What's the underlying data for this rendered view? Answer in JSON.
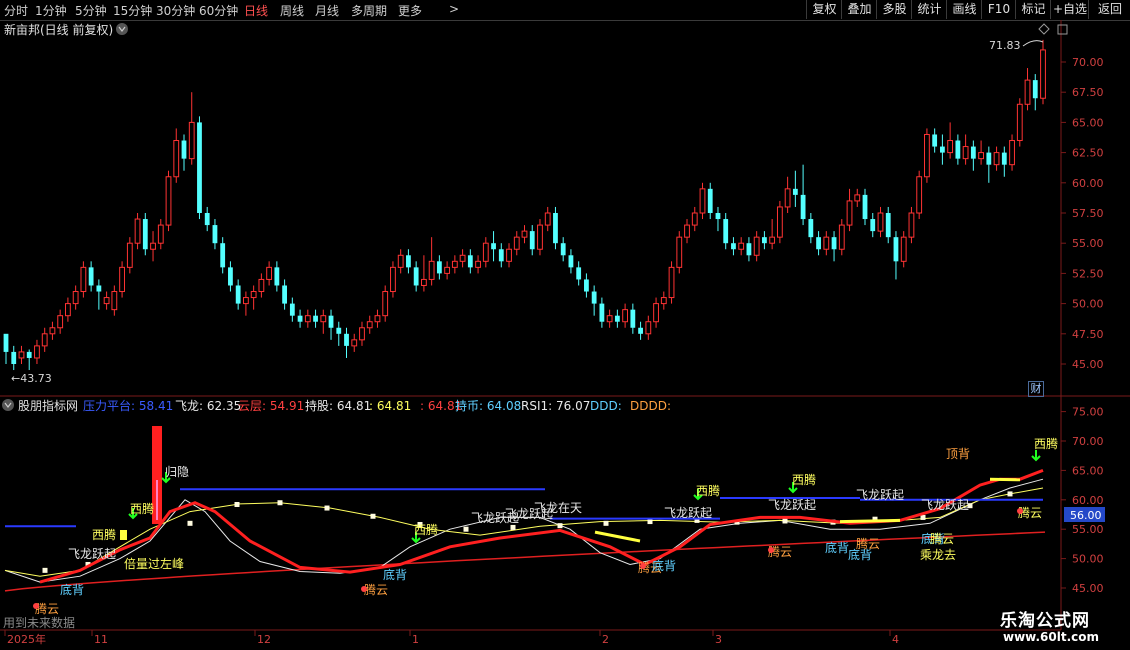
{
  "toolbar": {
    "timeframes": [
      "分时",
      "1分钟",
      "5分钟",
      "15分钟",
      "30分钟",
      "60分钟",
      "日线",
      "周线",
      "月线",
      "多周期",
      "更多"
    ],
    "active_index": 6,
    "more_arrow": ">",
    "buttons": [
      "复权",
      "叠加",
      "多股",
      "统计",
      "画线",
      "F10",
      "标记",
      "+自选",
      "返回"
    ]
  },
  "main_panel": {
    "title": "新亩邦(日线 前复权)",
    "price_ticks": [
      "70.00",
      "67.50",
      "65.00",
      "62.50",
      "60.00",
      "57.50",
      "55.00",
      "52.50",
      "50.00",
      "47.50",
      "45.00"
    ],
    "high_label": "71.83",
    "low_label": "43.73",
    "cai_badge": "财"
  },
  "indicator_panel": {
    "name": "股朋指标网",
    "legend": [
      {
        "text": "压力平台: 58.41",
        "color": "#3a5bff"
      },
      {
        "text": "飞龙: 62.35",
        "color": "#e8e8e8"
      },
      {
        "text": "云层: 54.91",
        "color": "#ff4040"
      },
      {
        "text": "持股: 64.81",
        "color": "#e8e8e8"
      },
      {
        "text": ": 64.81",
        "color": "#ffff60"
      },
      {
        "text": ": 64.81",
        "color": "#ff4040"
      },
      {
        "text": "持币: 64.08",
        "color": "#60d0ff"
      },
      {
        "text": "RSI1: 76.07",
        "color": "#e8e8e8"
      },
      {
        "text": "DDD:",
        "color": "#60d0ff"
      },
      {
        "text": "DDDD:",
        "color": "#ffa040"
      }
    ],
    "ticks": [
      "75.00",
      "70.00",
      "65.00",
      "60.00",
      "55.00",
      "50.00",
      "45.00"
    ],
    "current_value": "56.00",
    "annotations": {
      "tengyun": "腾云",
      "dibei": "底背",
      "feilong": "飞龙跃起",
      "xilong": "西腾",
      "guiyin": "归隐",
      "beiliang": "倍量过左峰",
      "feilong_sky": "飞龙在天",
      "dingbei": "顶背",
      "chenglong": "乘龙去",
      "beifang": "底背",
      "tengyun2": "腾云"
    }
  },
  "date_axis": [
    "2025年",
    "11",
    "12",
    "1",
    "2",
    "3",
    "4"
  ],
  "footer_note": "用到未来数据",
  "watermark": {
    "cn": "乐淘公式网",
    "url": "www.60lt.com"
  },
  "chart_data": {
    "type": "candlestick",
    "candles": [
      [
        47.5,
        46.0,
        45.0,
        47.0
      ],
      [
        46.0,
        45.0,
        44.5,
        46.5
      ],
      [
        45.5,
        46.0,
        45.0,
        46.5
      ],
      [
        46.0,
        45.5,
        44.5,
        46.2
      ],
      [
        45.5,
        46.5,
        45.0,
        47.0
      ],
      [
        46.5,
        47.5,
        46.0,
        48.0
      ],
      [
        47.5,
        48.0,
        47.0,
        48.5
      ],
      [
        48.0,
        49.0,
        47.5,
        49.5
      ],
      [
        49.0,
        50.0,
        48.5,
        50.5
      ],
      [
        50.0,
        51.0,
        49.5,
        51.5
      ],
      [
        51.0,
        53.0,
        50.5,
        53.5
      ],
      [
        53.0,
        51.5,
        51.0,
        53.5
      ],
      [
        51.5,
        51.0,
        49.5,
        52.0
      ],
      [
        50.0,
        50.5,
        49.5,
        51.0
      ],
      [
        49.5,
        51.0,
        49.0,
        51.5
      ],
      [
        51.0,
        53.0,
        50.5,
        53.5
      ],
      [
        53.0,
        55.0,
        52.5,
        55.5
      ],
      [
        55.0,
        57.0,
        54.5,
        57.5
      ],
      [
        57.0,
        54.5,
        54.0,
        57.5
      ],
      [
        54.5,
        55.0,
        53.5,
        56.0
      ],
      [
        55.0,
        56.5,
        54.5,
        57.0
      ],
      [
        56.5,
        60.5,
        56.0,
        61.0
      ],
      [
        60.5,
        63.5,
        60.0,
        64.5
      ],
      [
        63.5,
        62.0,
        61.0,
        64.0
      ],
      [
        62.0,
        65.0,
        61.5,
        67.5
      ],
      [
        65.0,
        57.5,
        57.0,
        65.5
      ],
      [
        57.5,
        56.5,
        56.0,
        58.0
      ],
      [
        56.5,
        55.0,
        54.5,
        57.0
      ],
      [
        55.0,
        53.0,
        52.5,
        55.5
      ],
      [
        53.0,
        51.5,
        51.0,
        53.5
      ],
      [
        51.5,
        50.0,
        49.5,
        52.0
      ],
      [
        50.0,
        50.5,
        49.0,
        51.0
      ],
      [
        50.5,
        51.0,
        49.5,
        51.5
      ],
      [
        51.0,
        52.0,
        50.5,
        52.5
      ],
      [
        52.0,
        53.0,
        51.5,
        53.5
      ],
      [
        53.0,
        51.5,
        51.0,
        53.5
      ],
      [
        51.5,
        50.0,
        49.5,
        52.0
      ],
      [
        50.0,
        49.0,
        48.5,
        50.5
      ],
      [
        49.0,
        48.5,
        48.0,
        49.5
      ],
      [
        48.5,
        49.0,
        48.0,
        49.5
      ],
      [
        49.0,
        48.5,
        48.0,
        49.5
      ],
      [
        48.5,
        49.0,
        47.5,
        49.5
      ],
      [
        49.0,
        48.0,
        47.0,
        49.5
      ],
      [
        48.0,
        47.5,
        46.5,
        48.5
      ],
      [
        47.5,
        46.5,
        45.5,
        48.0
      ],
      [
        46.5,
        47.0,
        46.0,
        47.5
      ],
      [
        47.0,
        48.0,
        46.5,
        48.5
      ],
      [
        48.0,
        48.5,
        47.5,
        49.0
      ],
      [
        48.5,
        49.0,
        48.0,
        49.5
      ],
      [
        49.0,
        51.0,
        48.5,
        51.5
      ],
      [
        51.0,
        53.0,
        50.5,
        53.5
      ],
      [
        53.0,
        54.0,
        52.5,
        54.5
      ],
      [
        54.0,
        53.0,
        52.5,
        54.5
      ],
      [
        53.0,
        51.5,
        51.0,
        53.5
      ],
      [
        51.5,
        52.0,
        51.0,
        54.0
      ],
      [
        52.0,
        53.5,
        51.5,
        55.5
      ],
      [
        53.5,
        52.5,
        52.0,
        54.0
      ],
      [
        52.5,
        53.0,
        52.0,
        53.5
      ],
      [
        53.0,
        53.5,
        52.5,
        54.0
      ],
      [
        53.5,
        54.0,
        53.0,
        54.5
      ],
      [
        54.0,
        53.0,
        52.5,
        54.5
      ],
      [
        53.0,
        53.5,
        52.5,
        54.0
      ],
      [
        53.5,
        55.0,
        53.0,
        55.5
      ],
      [
        55.0,
        54.5,
        53.5,
        56.0
      ],
      [
        54.5,
        53.5,
        53.0,
        55.0
      ],
      [
        53.5,
        54.5,
        53.0,
        55.0
      ],
      [
        54.5,
        55.5,
        54.0,
        56.0
      ],
      [
        55.5,
        56.0,
        55.0,
        56.5
      ],
      [
        56.0,
        54.5,
        54.0,
        56.5
      ],
      [
        54.5,
        56.5,
        54.0,
        57.0
      ],
      [
        56.5,
        57.5,
        56.0,
        58.0
      ],
      [
        57.5,
        55.0,
        54.5,
        58.0
      ],
      [
        55.0,
        54.0,
        53.5,
        55.5
      ],
      [
        54.0,
        53.0,
        52.5,
        54.5
      ],
      [
        53.0,
        52.0,
        51.5,
        53.5
      ],
      [
        52.0,
        51.0,
        50.5,
        52.5
      ],
      [
        51.0,
        50.0,
        49.0,
        51.5
      ],
      [
        50.0,
        48.5,
        48.0,
        50.5
      ],
      [
        48.5,
        49.0,
        48.0,
        49.5
      ],
      [
        49.0,
        48.5,
        48.0,
        49.5
      ],
      [
        48.5,
        49.5,
        48.0,
        50.0
      ],
      [
        49.5,
        48.0,
        47.5,
        50.0
      ],
      [
        48.0,
        47.5,
        47.0,
        48.5
      ],
      [
        47.5,
        48.5,
        47.0,
        49.0
      ],
      [
        48.5,
        50.0,
        48.0,
        50.5
      ],
      [
        50.0,
        50.5,
        49.5,
        51.0
      ],
      [
        50.5,
        53.0,
        50.0,
        53.5
      ],
      [
        53.0,
        55.5,
        52.5,
        56.0
      ],
      [
        55.5,
        56.5,
        55.0,
        57.0
      ],
      [
        56.5,
        57.5,
        56.0,
        58.0
      ],
      [
        57.5,
        59.5,
        57.0,
        60.0
      ],
      [
        59.5,
        57.5,
        57.0,
        60.0
      ],
      [
        57.5,
        57.0,
        56.0,
        58.0
      ],
      [
        57.0,
        55.0,
        54.5,
        57.5
      ],
      [
        55.0,
        54.5,
        54.0,
        55.5
      ],
      [
        54.5,
        55.0,
        54.0,
        55.5
      ],
      [
        55.0,
        54.0,
        53.5,
        55.5
      ],
      [
        54.0,
        55.5,
        53.5,
        56.0
      ],
      [
        55.5,
        55.0,
        54.5,
        56.0
      ],
      [
        55.0,
        55.5,
        54.5,
        57.0
      ],
      [
        55.5,
        58.0,
        55.0,
        58.5
      ],
      [
        58.0,
        59.5,
        57.5,
        60.5
      ],
      [
        59.5,
        59.0,
        58.0,
        61.0
      ],
      [
        59.0,
        57.0,
        56.5,
        61.5
      ],
      [
        57.0,
        55.5,
        55.0,
        57.5
      ],
      [
        55.5,
        54.5,
        54.0,
        56.0
      ],
      [
        54.5,
        55.5,
        54.0,
        56.0
      ],
      [
        55.5,
        54.5,
        53.5,
        56.0
      ],
      [
        54.5,
        56.5,
        54.0,
        57.0
      ],
      [
        56.5,
        58.5,
        56.0,
        59.5
      ],
      [
        58.5,
        59.0,
        58.0,
        59.5
      ],
      [
        59.0,
        57.0,
        56.5,
        59.5
      ],
      [
        57.0,
        56.0,
        55.5,
        57.5
      ],
      [
        56.0,
        57.5,
        55.5,
        58.0
      ],
      [
        57.5,
        55.5,
        55.0,
        58.0
      ],
      [
        55.5,
        53.5,
        52.0,
        56.0
      ],
      [
        53.5,
        55.5,
        53.0,
        56.0
      ],
      [
        55.5,
        57.5,
        55.0,
        58.0
      ],
      [
        57.5,
        60.5,
        57.0,
        61.0
      ],
      [
        60.5,
        64.0,
        60.0,
        64.5
      ],
      [
        64.0,
        63.0,
        62.5,
        64.5
      ],
      [
        63.0,
        62.5,
        61.5,
        64.0
      ],
      [
        62.5,
        63.5,
        62.0,
        65.0
      ],
      [
        63.5,
        62.0,
        61.5,
        64.0
      ],
      [
        62.0,
        63.0,
        61.5,
        64.0
      ],
      [
        63.0,
        62.0,
        61.0,
        63.5
      ],
      [
        62.0,
        62.5,
        61.5,
        63.5
      ],
      [
        62.5,
        61.5,
        60.0,
        63.0
      ],
      [
        61.5,
        62.5,
        61.0,
        63.0
      ],
      [
        62.5,
        61.5,
        60.5,
        63.0
      ],
      [
        61.5,
        63.5,
        61.0,
        64.0
      ],
      [
        63.5,
        66.5,
        63.0,
        67.0
      ],
      [
        66.5,
        68.5,
        66.0,
        69.5
      ],
      [
        68.5,
        67.0,
        66.0,
        69.0
      ],
      [
        67.0,
        71.0,
        66.5,
        71.83
      ]
    ]
  }
}
